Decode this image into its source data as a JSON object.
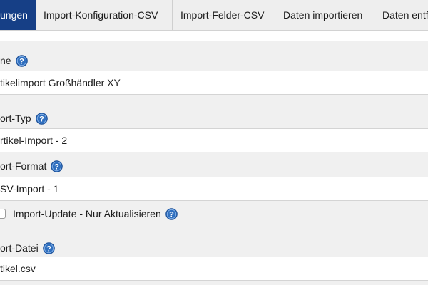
{
  "tabs": [
    {
      "label": "ungen",
      "active": true
    },
    {
      "label": "Import-Konfiguration-CSV",
      "active": false
    },
    {
      "label": "Import-Felder-CSV",
      "active": false
    },
    {
      "label": "Daten importieren",
      "active": false
    },
    {
      "label": "Daten entf",
      "active": false
    }
  ],
  "form": {
    "name": {
      "label": "ne",
      "value": "tikelimport Großhändler XY"
    },
    "import_type": {
      "label": "ort-Typ",
      "value": "rtikel-Import - 2"
    },
    "import_format": {
      "label": "ort-Format",
      "value": "SV-Import - 1"
    },
    "update_only": {
      "label": "Import-Update - Nur Aktualisieren",
      "checked": false
    },
    "import_file": {
      "label": "ort-Datei",
      "value": "tikel.csv"
    }
  },
  "icons": {
    "help": "help-question-icon"
  },
  "colors": {
    "active_tab": "#163f86",
    "help_icon": "#2f6fbf",
    "panel": "#f0f0f0"
  }
}
